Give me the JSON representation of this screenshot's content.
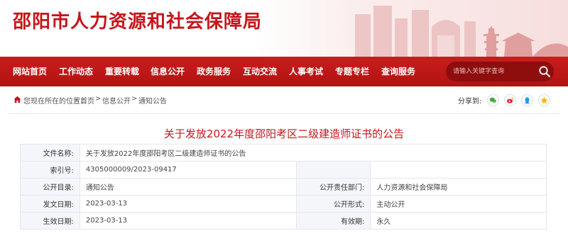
{
  "site": {
    "title": "邵阳市人力资源和社会保障局"
  },
  "nav": {
    "items": [
      {
        "label": "网站首页"
      },
      {
        "label": "工作动态"
      },
      {
        "label": "重要转载"
      },
      {
        "label": "信息公开"
      },
      {
        "label": "政务服务"
      },
      {
        "label": "互动交流"
      },
      {
        "label": "人事考试"
      },
      {
        "label": "专题专栏"
      },
      {
        "label": "查询服务"
      }
    ],
    "search_placeholder": "请输入关键字查询"
  },
  "breadcrumb": {
    "prefix": "您现在所在的位置：",
    "items": [
      {
        "label": "首页"
      },
      {
        "label": "信息公开"
      },
      {
        "label": "通知公告"
      }
    ],
    "separator": ">"
  },
  "share": {
    "label": "分享到:",
    "icons": [
      "wechat-icon",
      "weibo-icon",
      "qq-icon",
      "qzone-icon"
    ],
    "colors": {
      "wechat": "#3dab3e",
      "weibo": "#e6162d",
      "qq": "#1a9fe0",
      "qzone": "#f5b50b"
    }
  },
  "article": {
    "title": "关于发放2022年度邵阳考区二级建造师证书的公告",
    "meta": {
      "file_name_label": "文件名称:",
      "file_name": "关于发放2022年度邵阳考区二级建造师证书的公告",
      "index_label": "索引号:",
      "index": "4305000009/2023-09417",
      "catalog_label": "公开目录:",
      "catalog": "通知公告",
      "dept_label": "公开责任部门:",
      "dept": "人力资源和社会保障局",
      "date_label": "发文日期:",
      "date": "2023-03-13",
      "form_label": "公开形式:",
      "form": "主动公开",
      "effective_label": "生效日期:",
      "effective": "2023-03-13",
      "validity_label": "有效期:",
      "validity": "永久"
    }
  },
  "colors": {
    "brand": "#c4161c",
    "nav_bg": "#b31212"
  }
}
